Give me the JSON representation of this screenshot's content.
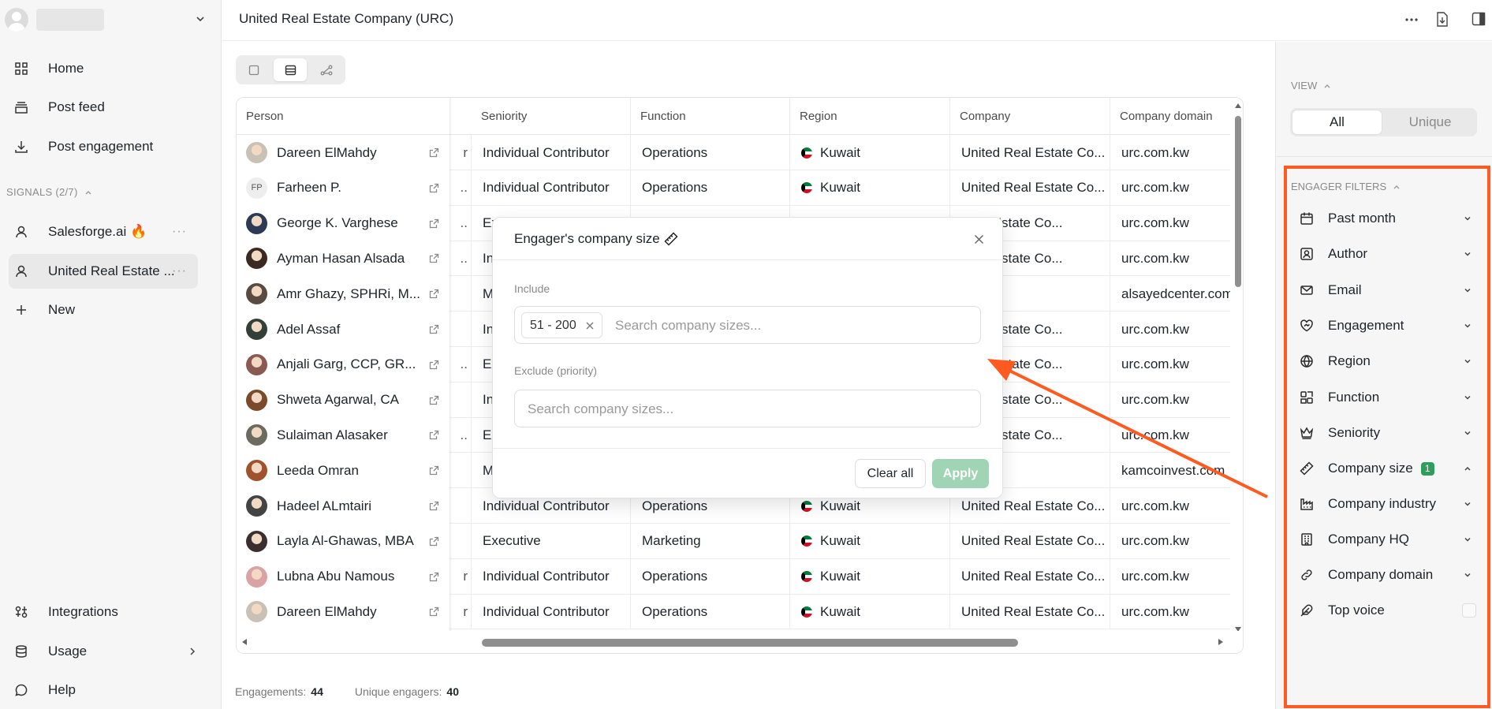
{
  "sidebar": {
    "nav": [
      {
        "label": "Home",
        "icon": "grid-icon"
      },
      {
        "label": "Post feed",
        "icon": "stack-icon"
      },
      {
        "label": "Post engagement",
        "icon": "download-icon"
      }
    ],
    "signals_header": "SIGNALS (2/7)",
    "signals": [
      {
        "label": "Salesforge.ai 🔥",
        "icon": "user-icon"
      },
      {
        "label": "United Real Estate ...",
        "icon": "user-icon"
      }
    ],
    "new_label": "New",
    "bottom": [
      {
        "label": "Integrations",
        "icon": "integrations-icon"
      },
      {
        "label": "Usage",
        "icon": "database-icon"
      },
      {
        "label": "Help",
        "icon": "chat-bubble-icon"
      }
    ]
  },
  "topbar": {
    "title": "United Real Estate Company (URC)"
  },
  "table": {
    "columns": [
      "Person",
      "Seniority",
      "Function",
      "Region",
      "Company",
      "Company domain"
    ],
    "rows": [
      {
        "person": "Dareen ElMahdy",
        "frag": "r",
        "seniority": "Individual Contributor",
        "function": "Operations",
        "region": "Kuwait",
        "company": "United Real Estate Co...",
        "domain": "urc.com.kw",
        "avatar": "#c9c1b6"
      },
      {
        "person": "Farheen P.",
        "frag": "..",
        "seniority": "Individual Contributor",
        "function": "Operations",
        "region": "Kuwait",
        "company": "United Real Estate Co...",
        "domain": "urc.com.kw",
        "initials": "FP"
      },
      {
        "person": "George K. Varghese",
        "frag": "..",
        "seniority": "Ex",
        "function": "",
        "region": "",
        "company": "Real Estate Co...",
        "domain": "urc.com.kw",
        "avatar": "#2c3a55"
      },
      {
        "person": "Ayman Hasan Alsada",
        "frag": "..",
        "seniority": "In",
        "function": "",
        "region": "",
        "company": "Real Estate Co...",
        "domain": "urc.com.kw",
        "avatar": "#3a2a22"
      },
      {
        "person": "Amr Ghazy, SPHRi, M...",
        "frag": "",
        "seniority": "M",
        "function": "",
        "region": "",
        "company": "",
        "domain": "alsayedcenter.com",
        "avatar": "#5a4b40"
      },
      {
        "person": "Adel Assaf",
        "frag": "",
        "seniority": "In",
        "function": "",
        "region": "",
        "company": "Real Estate Co...",
        "domain": "urc.com.kw",
        "avatar": "#33403a"
      },
      {
        "person": "Anjali Garg, CCP, GR...",
        "frag": "..",
        "seniority": "Ex",
        "function": "",
        "region": "",
        "company": "Real Estate Co...",
        "domain": "urc.com.kw",
        "avatar": "#8a5a52"
      },
      {
        "person": "Shweta Agarwal, CA",
        "frag": "",
        "seniority": "In",
        "function": "",
        "region": "",
        "company": "Real Estate Co...",
        "domain": "urc.com.kw",
        "avatar": "#7a4a2a"
      },
      {
        "person": "Sulaiman Alasaker",
        "frag": "..",
        "seniority": "Ex",
        "function": "",
        "region": "",
        "company": "Real Estate Co...",
        "domain": "urc.com.kw",
        "avatar": "#6b6b60"
      },
      {
        "person": "Leeda Omran",
        "frag": "",
        "seniority": "M",
        "function": "",
        "region": "",
        "company": "Invest",
        "domain": "kamcoinvest.com",
        "avatar": "#a0522d"
      },
      {
        "person": "Hadeel ALmtairi",
        "frag": "",
        "seniority": "Individual Contributor",
        "function": "Operations",
        "region": "Kuwait",
        "company": "United Real Estate Co...",
        "domain": "urc.com.kw",
        "avatar": "#444"
      },
      {
        "person": "Layla Al-Ghawas, MBA",
        "frag": "",
        "seniority": "Executive",
        "function": "Marketing",
        "region": "Kuwait",
        "company": "United Real Estate Co...",
        "domain": "urc.com.kw",
        "avatar": "#3a2e2e"
      },
      {
        "person": "Lubna Abu Namous",
        "frag": "r",
        "seniority": "Individual Contributor",
        "function": "Operations",
        "region": "Kuwait",
        "company": "United Real Estate Co...",
        "domain": "urc.com.kw",
        "avatar": "#d9a3a3"
      },
      {
        "person": "Dareen ElMahdy",
        "frag": "r",
        "seniority": "Individual Contributor",
        "function": "Operations",
        "region": "Kuwait",
        "company": "United Real Estate Co...",
        "domain": "urc.com.kw",
        "avatar": "#c9c1b6"
      }
    ]
  },
  "footer": {
    "engagements_label": "Engagements:",
    "engagements": "44",
    "unique_label": "Unique engagers:",
    "unique": "40"
  },
  "modal": {
    "title": "Engager's company size",
    "include_label": "Include",
    "include_chip": "51 - 200",
    "include_placeholder": "Search company sizes...",
    "exclude_label": "Exclude (priority)",
    "exclude_placeholder": "Search company sizes...",
    "clear_label": "Clear all",
    "apply_label": "Apply"
  },
  "right_panel": {
    "view_header": "VIEW",
    "view_all": "All",
    "view_unique": "Unique",
    "filters_header": "ENGAGER FILTERS",
    "filters": [
      {
        "label": "Past month",
        "icon": "calendar-icon"
      },
      {
        "label": "Author",
        "icon": "author-icon"
      },
      {
        "label": "Email",
        "icon": "mail-icon"
      },
      {
        "label": "Engagement",
        "icon": "heart-handshake-icon"
      },
      {
        "label": "Region",
        "icon": "globe-icon"
      },
      {
        "label": "Function",
        "icon": "function-icon"
      },
      {
        "label": "Seniority",
        "icon": "crown-icon"
      },
      {
        "label": "Company size",
        "icon": "ruler-icon",
        "badge": "1"
      },
      {
        "label": "Company industry",
        "icon": "factory-icon"
      },
      {
        "label": "Company HQ",
        "icon": "building-icon"
      },
      {
        "label": "Company domain",
        "icon": "link-icon"
      },
      {
        "label": "Top voice",
        "icon": "feather-icon"
      }
    ]
  },
  "colors": {
    "annotation": "#ff5a1f",
    "apply_button": "#9fd4b4",
    "badge": "#2f9e5c"
  }
}
